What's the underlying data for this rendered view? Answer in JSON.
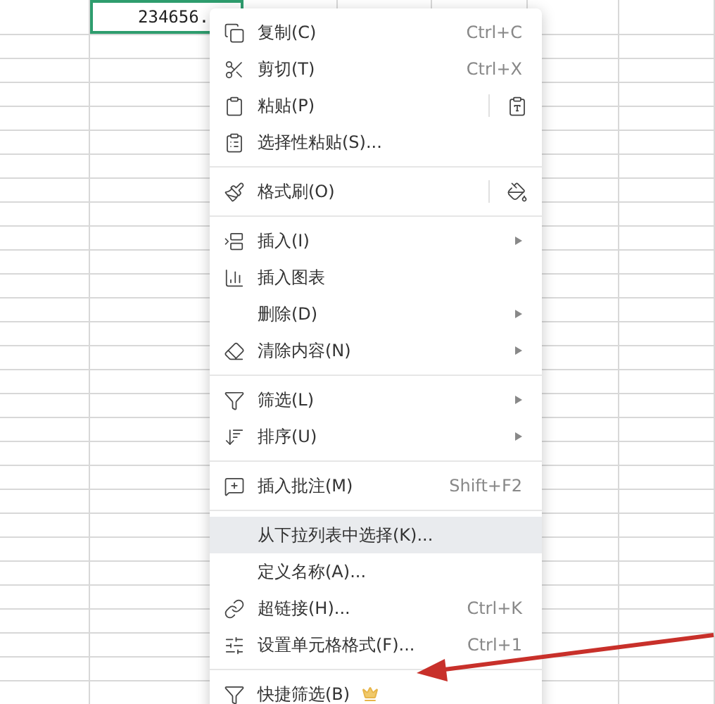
{
  "sheet": {
    "cell_value": "234656."
  },
  "context_menu": {
    "groups": [
      {
        "items": [
          {
            "label": "复制(C)",
            "shortcut": "Ctrl+C",
            "submenu": false,
            "split": false,
            "selected": false
          },
          {
            "label": "剪切(T)",
            "shortcut": "Ctrl+X",
            "submenu": false,
            "split": false,
            "selected": false
          },
          {
            "label": "粘贴(P)",
            "submenu": false,
            "split": true,
            "selected": false
          },
          {
            "label": "选择性粘贴(S)...",
            "submenu": false,
            "split": false,
            "selected": false
          }
        ]
      },
      {
        "items": [
          {
            "label": "格式刷(O)",
            "submenu": false,
            "split": true,
            "selected": false
          }
        ]
      },
      {
        "items": [
          {
            "label": "插入(I)",
            "submenu": true,
            "split": false,
            "selected": false
          },
          {
            "label": "插入图表",
            "submenu": false,
            "split": false,
            "selected": false
          },
          {
            "label": "删除(D)",
            "submenu": true,
            "split": false,
            "selected": false
          },
          {
            "label": "清除内容(N)",
            "submenu": true,
            "split": false,
            "selected": false
          }
        ]
      },
      {
        "items": [
          {
            "label": "筛选(L)",
            "submenu": true,
            "split": false,
            "selected": false
          },
          {
            "label": "排序(U)",
            "submenu": true,
            "split": false,
            "selected": false
          }
        ]
      },
      {
        "items": [
          {
            "label": "插入批注(M)",
            "shortcut": "Shift+F2",
            "submenu": false,
            "split": false,
            "selected": false
          }
        ]
      },
      {
        "items": [
          {
            "label": "从下拉列表中选择(K)...",
            "submenu": false,
            "split": false,
            "selected": true
          },
          {
            "label": "定义名称(A)...",
            "submenu": false,
            "split": false,
            "selected": false
          },
          {
            "label": "超链接(H)...",
            "shortcut": "Ctrl+K",
            "submenu": false,
            "split": false,
            "selected": false
          },
          {
            "label": "设置单元格格式(F)...",
            "shortcut": "Ctrl+1",
            "submenu": false,
            "split": false,
            "selected": false
          }
        ]
      },
      {
        "items": [
          {
            "label": "快捷筛选(B)",
            "submenu": false,
            "split": false,
            "selected": false,
            "premium": true
          }
        ]
      }
    ]
  }
}
